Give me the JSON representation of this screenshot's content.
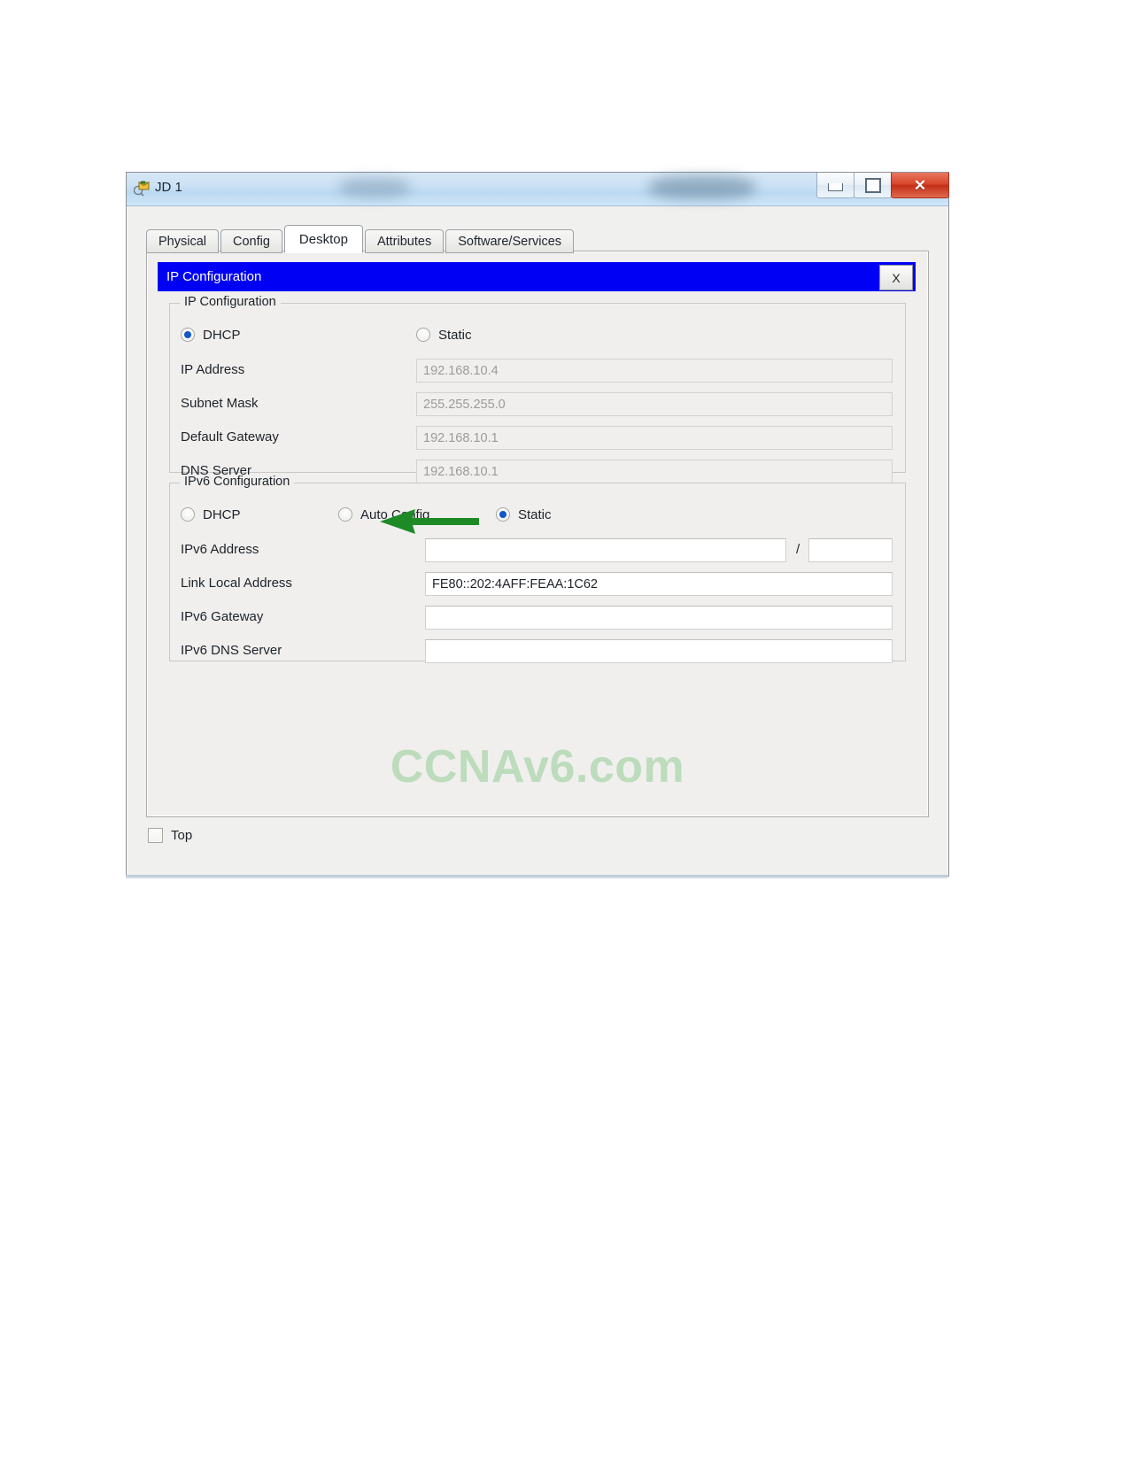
{
  "window": {
    "title": "JD 1",
    "icon": "packet-tracer-device-icon",
    "controls": {
      "minimize": "minimize-icon",
      "maximize": "maximize-icon",
      "close": "✕"
    }
  },
  "tabs": [
    {
      "label": "Physical",
      "active": false
    },
    {
      "label": "Config",
      "active": false
    },
    {
      "label": "Desktop",
      "active": true
    },
    {
      "label": "Attributes",
      "active": false
    },
    {
      "label": "Software/Services",
      "active": false
    }
  ],
  "dialog": {
    "title": "IP Configuration",
    "close_label": "X"
  },
  "ipv4": {
    "legend": "IP Configuration",
    "modes": [
      {
        "label": "DHCP",
        "selected": true
      },
      {
        "label": "Static",
        "selected": false
      }
    ],
    "fields": [
      {
        "label": "IP Address",
        "value": "192.168.10.4",
        "disabled": true
      },
      {
        "label": "Subnet Mask",
        "value": "255.255.255.0",
        "disabled": true
      },
      {
        "label": "Default Gateway",
        "value": "192.168.10.1",
        "disabled": true
      },
      {
        "label": "DNS Server",
        "value": "192.168.10.1",
        "disabled": true
      }
    ]
  },
  "ipv6": {
    "legend": "IPv6 Configuration",
    "modes": [
      {
        "label": "DHCP",
        "selected": false
      },
      {
        "label": "Auto Config",
        "selected": false
      },
      {
        "label": "Static",
        "selected": true
      }
    ],
    "address_label": "IPv6 Address",
    "address_value": "",
    "prefix_separator": "/",
    "prefix_value": "",
    "fields": [
      {
        "label": "Link Local Address",
        "value": "FE80::202:4AFF:FEAA:1C62",
        "disabled": false
      },
      {
        "label": "IPv6 Gateway",
        "value": "",
        "disabled": false
      },
      {
        "label": "IPv6 DNS Server",
        "value": "",
        "disabled": false
      }
    ]
  },
  "watermark": "CCNAv6.com",
  "bottom": {
    "top_checkbox_label": "Top",
    "top_checkbox_checked": false
  },
  "annotation": {
    "arrow": "green-left-arrow",
    "arrow_color": "#1d8a26"
  },
  "colors": {
    "dialog_title_bg": "#0000f5",
    "accent_radio": "#1158c8",
    "watermark": "#bcdcbb",
    "close_button": "#c32f17"
  }
}
